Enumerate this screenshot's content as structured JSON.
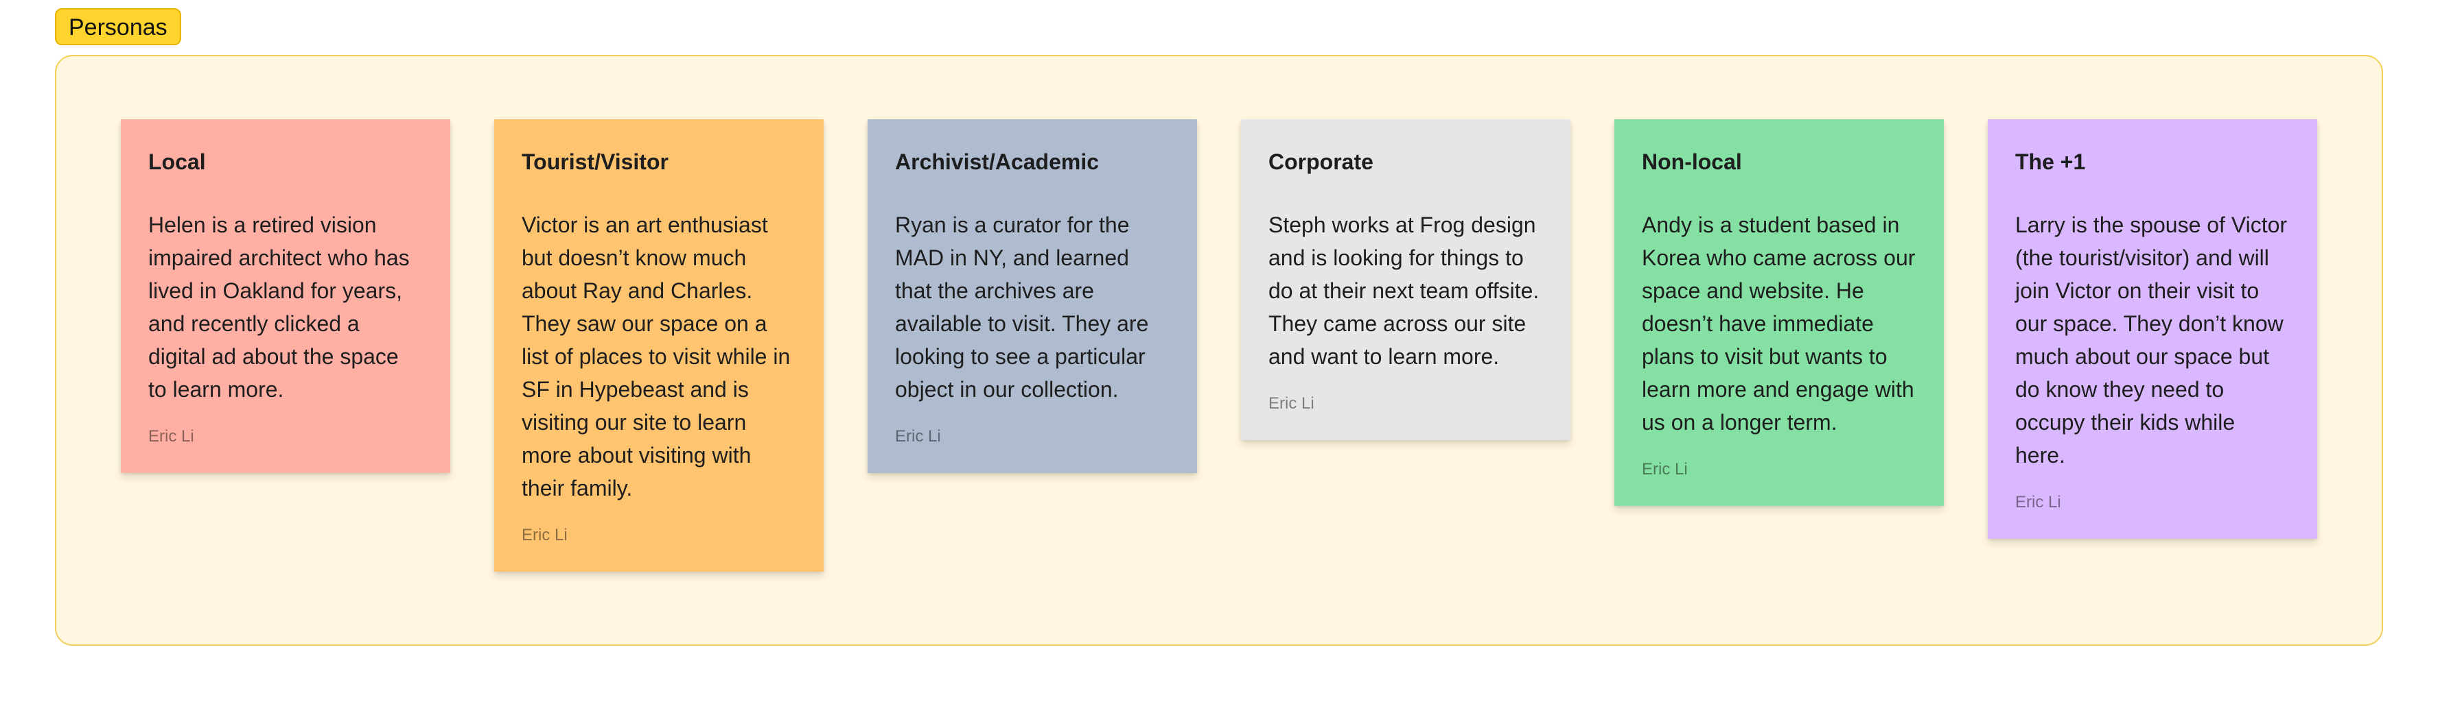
{
  "section": {
    "label": "Personas",
    "label_color": "#ffd42e",
    "frame_color": "#fff7df",
    "frame_border_color": "#f2cf5a"
  },
  "stickies": [
    {
      "title": "Local",
      "body": "Helen is a retired vision impaired architect who has lived in Oakland for years, and recently clicked a digital ad about the space to learn more.",
      "author": "Eric Li",
      "color": "#ffafa3"
    },
    {
      "title": "Tourist/Visitor",
      "body": "Victor is an art enthusiast but doesn’t know much about Ray and Charles. They saw our space on a list of places to visit while in SF in Hypebeast and is visiting our site to learn more about visiting with their family.",
      "author": "Eric Li",
      "color": "#ffc470"
    },
    {
      "title": "Archivist/Academic",
      "body": "Ryan is a curator for the MAD in NY, and learned that the archives are available to visit. They are looking to see a particular object in our collection.",
      "author": "Eric Li",
      "color": "#afbccf"
    },
    {
      "title": "Corporate",
      "body": "Steph works at Frog design and is looking for things to do at their next team offsite. They came across our site and want to learn more.",
      "author": "Eric Li",
      "color": "#e6e6e6"
    },
    {
      "title": "Non-local",
      "body": "Andy is a student based in Korea who came across our space and website. He doesn’t have immediate plans to visit but wants to learn more and engage with us on a longer term.",
      "author": "Eric Li",
      "color": "#85e0a3"
    },
    {
      "title": "The +1",
      "body": "Larry is the spouse of Victor (the tourist/visitor) and will join Victor on their visit to our space. They don’t know much about our space but do know they need to occupy their kids while here.",
      "author": "Eric Li",
      "color": "#d9b8ff"
    }
  ]
}
